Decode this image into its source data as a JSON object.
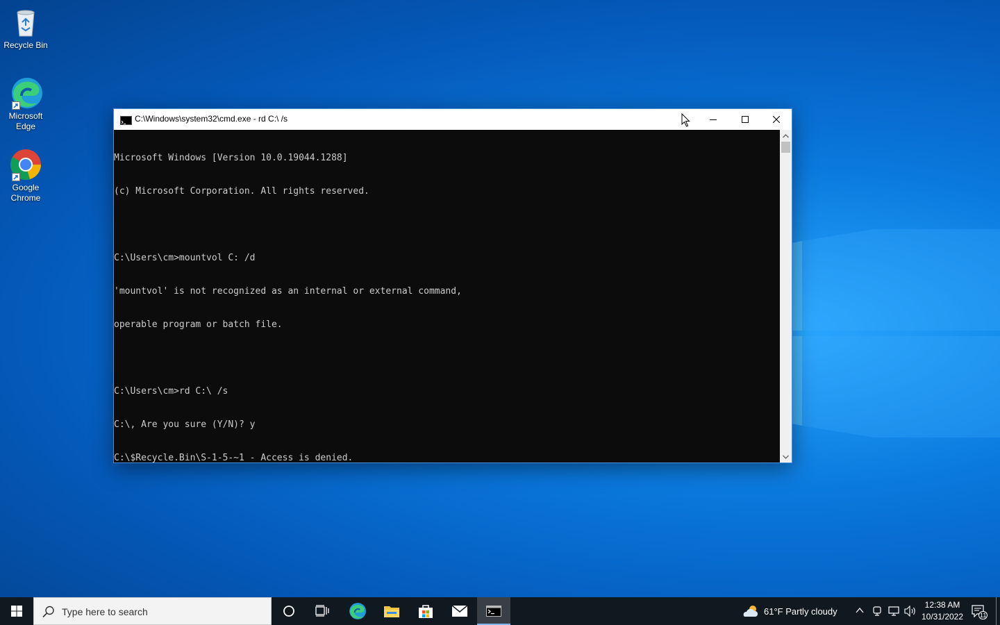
{
  "desktop": {
    "icons": [
      {
        "label": "Recycle Bin"
      },
      {
        "label": "Microsoft Edge"
      },
      {
        "label": "Google Chrome"
      }
    ]
  },
  "cmd_window": {
    "title": "C:\\Windows\\system32\\cmd.exe - rd  C:\\ /s",
    "lines": [
      "Microsoft Windows [Version 10.0.19044.1288]",
      "(c) Microsoft Corporation. All rights reserved.",
      "",
      "C:\\Users\\cm>mountvol C: /d",
      "'mountvol' is not recognized as an internal or external command,",
      "operable program or batch file.",
      "",
      "C:\\Users\\cm>rd C:\\ /s",
      "C:\\, Are you sure (Y/N)? y",
      "C:\\$Recycle.Bin\\S-1-5-~1 - Access is denied."
    ],
    "colors": {
      "background": "#0c0c0c",
      "text": "#cccccc"
    }
  },
  "taskbar": {
    "search_placeholder": "Type here to search",
    "weather": "61°F  Partly cloudy",
    "time": "12:38 AM",
    "date": "10/31/2022",
    "notification_count": "11"
  }
}
